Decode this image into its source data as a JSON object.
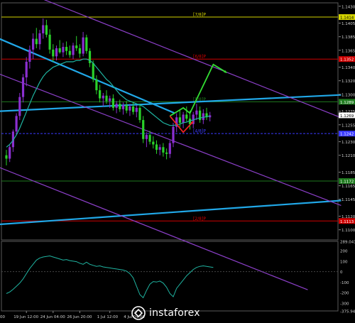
{
  "chart_data": {
    "type": "candlestick",
    "instrument_note": "",
    "price_axis": {
      "ylim": [
        1.1085,
        1.1435
      ],
      "tick_labels": [
        "1.1430",
        "1.1405",
        "1.1385",
        "1.1365",
        "1.1340",
        "1.1320",
        "1.1300",
        "1.1275",
        "1.1255",
        "1.1230",
        "1.1210",
        "1.1185",
        "1.1165",
        "1.1145",
        "1.1120",
        "1.1100"
      ],
      "price_tag": "1.1269"
    },
    "date_axis": {
      "tick_labels": [
        "19 Jun 12:00",
        "24 Jun 04:00",
        "26 Jun 20:00",
        "1 Jul 12:00",
        "4 Jul 04:00"
      ],
      "last_label_partial": "00"
    },
    "murray_levels": [
      {
        "label": "[7/8]P",
        "price": 1.1414,
        "tag": "1.1414",
        "color": "#d4d400"
      },
      {
        "label": "[6/8]P",
        "price": 1.1352,
        "tag": "1.1352",
        "color": "#d00000"
      },
      {
        "label": "[5/8]P",
        "price": 1.1289,
        "tag": "1.1289",
        "color": "#1e7a1e"
      },
      {
        "label": "[4/8]P",
        "price": 1.1242,
        "tag": "1.1242",
        "color": "#3a3aff"
      },
      {
        "label": "",
        "price": 1.1172,
        "tag": "1.1172",
        "color": "#1e7a1e"
      },
      {
        "label": "[2/8]P",
        "price": 1.1113,
        "tag": "1.1113",
        "color": "#d00000"
      }
    ],
    "candles": [
      {
        "o": 1.121,
        "h": 1.1218,
        "l": 1.1195,
        "c": 1.1205
      },
      {
        "o": 1.1205,
        "h": 1.1225,
        "l": 1.12,
        "c": 1.1222
      },
      {
        "o": 1.1222,
        "h": 1.1248,
        "l": 1.1215,
        "c": 1.1245
      },
      {
        "o": 1.1245,
        "h": 1.1272,
        "l": 1.124,
        "c": 1.1268
      },
      {
        "o": 1.1268,
        "h": 1.1302,
        "l": 1.1262,
        "c": 1.1296
      },
      {
        "o": 1.1296,
        "h": 1.133,
        "l": 1.1288,
        "c": 1.1325
      },
      {
        "o": 1.1325,
        "h": 1.1355,
        "l": 1.1312,
        "c": 1.1348
      },
      {
        "o": 1.1348,
        "h": 1.1372,
        "l": 1.1338,
        "c": 1.1366
      },
      {
        "o": 1.1366,
        "h": 1.139,
        "l": 1.1352,
        "c": 1.1382
      },
      {
        "o": 1.1382,
        "h": 1.1398,
        "l": 1.1368,
        "c": 1.1374
      },
      {
        "o": 1.1374,
        "h": 1.1395,
        "l": 1.1366,
        "c": 1.139
      },
      {
        "o": 1.139,
        "h": 1.1412,
        "l": 1.1382,
        "c": 1.1402
      },
      {
        "o": 1.1402,
        "h": 1.141,
        "l": 1.1384,
        "c": 1.1388
      },
      {
        "o": 1.1388,
        "h": 1.1396,
        "l": 1.136,
        "c": 1.1366
      },
      {
        "o": 1.1366,
        "h": 1.1374,
        "l": 1.1348,
        "c": 1.1356
      },
      {
        "o": 1.1356,
        "h": 1.1372,
        "l": 1.135,
        "c": 1.1368
      },
      {
        "o": 1.1368,
        "h": 1.138,
        "l": 1.136,
        "c": 1.1362
      },
      {
        "o": 1.1362,
        "h": 1.1376,
        "l": 1.1355,
        "c": 1.137
      },
      {
        "o": 1.137,
        "h": 1.1378,
        "l": 1.1358,
        "c": 1.1364
      },
      {
        "o": 1.1364,
        "h": 1.1372,
        "l": 1.1354,
        "c": 1.1358
      },
      {
        "o": 1.1358,
        "h": 1.1376,
        "l": 1.1352,
        "c": 1.1372
      },
      {
        "o": 1.1372,
        "h": 1.1386,
        "l": 1.1364,
        "c": 1.1368
      },
      {
        "o": 1.1368,
        "h": 1.1374,
        "l": 1.1354,
        "c": 1.136
      },
      {
        "o": 1.136,
        "h": 1.1392,
        "l": 1.1356,
        "c": 1.1384
      },
      {
        "o": 1.1384,
        "h": 1.1388,
        "l": 1.136,
        "c": 1.1364
      },
      {
        "o": 1.1364,
        "h": 1.1368,
        "l": 1.134,
        "c": 1.1346
      },
      {
        "o": 1.1346,
        "h": 1.135,
        "l": 1.1318,
        "c": 1.1322
      },
      {
        "o": 1.1322,
        "h": 1.1328,
        "l": 1.13,
        "c": 1.1306
      },
      {
        "o": 1.1306,
        "h": 1.1314,
        "l": 1.1288,
        "c": 1.1294
      },
      {
        "o": 1.1294,
        "h": 1.1302,
        "l": 1.1282,
        "c": 1.1298
      },
      {
        "o": 1.1298,
        "h": 1.1306,
        "l": 1.1286,
        "c": 1.129
      },
      {
        "o": 1.129,
        "h": 1.1298,
        "l": 1.128,
        "c": 1.1294
      },
      {
        "o": 1.1294,
        "h": 1.13,
        "l": 1.1276,
        "c": 1.128
      },
      {
        "o": 1.128,
        "h": 1.129,
        "l": 1.1272,
        "c": 1.1286
      },
      {
        "o": 1.1286,
        "h": 1.1292,
        "l": 1.1274,
        "c": 1.1278
      },
      {
        "o": 1.1278,
        "h": 1.1288,
        "l": 1.127,
        "c": 1.1284
      },
      {
        "o": 1.1284,
        "h": 1.129,
        "l": 1.1272,
        "c": 1.1276
      },
      {
        "o": 1.1276,
        "h": 1.1286,
        "l": 1.1268,
        "c": 1.1282
      },
      {
        "o": 1.1282,
        "h": 1.1288,
        "l": 1.127,
        "c": 1.1274
      },
      {
        "o": 1.1274,
        "h": 1.1284,
        "l": 1.1266,
        "c": 1.128
      },
      {
        "o": 1.128,
        "h": 1.1286,
        "l": 1.1258,
        "c": 1.1262
      },
      {
        "o": 1.1262,
        "h": 1.1268,
        "l": 1.1228,
        "c": 1.1234
      },
      {
        "o": 1.1234,
        "h": 1.1244,
        "l": 1.1222,
        "c": 1.124
      },
      {
        "o": 1.124,
        "h": 1.1246,
        "l": 1.1226,
        "c": 1.123
      },
      {
        "o": 1.123,
        "h": 1.1238,
        "l": 1.122,
        "c": 1.1226
      },
      {
        "o": 1.1226,
        "h": 1.1232,
        "l": 1.1212,
        "c": 1.1218
      },
      {
        "o": 1.1218,
        "h": 1.1226,
        "l": 1.121,
        "c": 1.1222
      },
      {
        "o": 1.1222,
        "h": 1.1228,
        "l": 1.1208,
        "c": 1.1214
      },
      {
        "o": 1.1214,
        "h": 1.122,
        "l": 1.1204,
        "c": 1.1212
      },
      {
        "o": 1.1212,
        "h": 1.1232,
        "l": 1.1206,
        "c": 1.1228
      },
      {
        "o": 1.1228,
        "h": 1.1258,
        "l": 1.1222,
        "c": 1.1252
      },
      {
        "o": 1.1252,
        "h": 1.1272,
        "l": 1.1244,
        "c": 1.1266
      },
      {
        "o": 1.1266,
        "h": 1.1278,
        "l": 1.1252,
        "c": 1.1258
      },
      {
        "o": 1.1258,
        "h": 1.1274,
        "l": 1.125,
        "c": 1.127
      },
      {
        "o": 1.127,
        "h": 1.1282,
        "l": 1.126,
        "c": 1.1264
      },
      {
        "o": 1.1264,
        "h": 1.1276,
        "l": 1.1248,
        "c": 1.1256
      },
      {
        "o": 1.1256,
        "h": 1.1274,
        "l": 1.125,
        "c": 1.127
      },
      {
        "o": 1.127,
        "h": 1.1286,
        "l": 1.1262,
        "c": 1.1276
      },
      {
        "o": 1.1276,
        "h": 1.1282,
        "l": 1.1258,
        "c": 1.1262
      },
      {
        "o": 1.1262,
        "h": 1.1278,
        "l": 1.1256,
        "c": 1.1272
      },
      {
        "o": 1.1272,
        "h": 1.128,
        "l": 1.1262,
        "c": 1.1266
      },
      {
        "o": 1.1266,
        "h": 1.1274,
        "l": 1.126,
        "c": 1.1269
      }
    ],
    "moving_average": [
      1.1222,
      1.1226,
      1.1232,
      1.124,
      1.125,
      1.1262,
      1.1274,
      1.1286,
      1.1298,
      1.1308,
      1.1318,
      1.1326,
      1.1332,
      1.1336,
      1.134,
      1.1342,
      1.1344,
      1.1346,
      1.1348,
      1.1348,
      1.1348,
      1.135,
      1.135,
      1.1352,
      1.1352,
      1.135,
      1.1346,
      1.134,
      1.1334,
      1.1328,
      1.1322,
      1.1318,
      1.1312,
      1.1306,
      1.13,
      1.1296,
      1.1292,
      1.129,
      1.1288,
      1.1286,
      1.1284,
      1.1282,
      1.1278,
      1.1274,
      1.127,
      1.1266,
      1.1262,
      1.1258,
      1.1256,
      1.1254,
      1.1254,
      1.1255,
      1.1256,
      1.1258,
      1.1259,
      1.1261,
      1.1262,
      1.1264,
      1.1265,
      1.1266,
      1.1267,
      1.1268
    ],
    "channel_lines": [
      {
        "color": "#21a8e8",
        "points": [
          [
            0,
            1.1275
          ],
          [
            62,
            1.1338
          ]
        ]
      },
      {
        "color": "#21a8e8",
        "points": [
          [
            0,
            1.1108
          ],
          [
            62,
            1.12
          ]
        ]
      },
      {
        "color": "#21a8e8",
        "points": [
          [
            0,
            1.1382
          ],
          [
            12,
            1.1432
          ]
        ]
      }
    ],
    "trend_lines": [
      {
        "color": "#8b3fc8",
        "points": [
          [
            0,
            1.133
          ],
          [
            62,
            1.121
          ]
        ]
      },
      {
        "color": "#8b3fc8",
        "points": [
          [
            0,
            1.1192
          ],
          [
            52,
            1.1088
          ]
        ]
      },
      {
        "color": "#8b3fc8",
        "points": [
          [
            0,
            1.1466
          ],
          [
            62,
            1.1342
          ]
        ]
      }
    ],
    "forecast_paths": [
      {
        "color": "#33dd33",
        "points": [
          [
            49,
            1.1268
          ],
          [
            53,
            1.128
          ],
          [
            55,
            1.1272
          ],
          [
            62,
            1.1344
          ],
          [
            66,
            1.1332
          ]
        ]
      },
      {
        "color": "#ee2222",
        "points": [
          [
            49,
            1.1268
          ],
          [
            53,
            1.1244
          ],
          [
            56,
            1.126
          ]
        ]
      }
    ],
    "oscillator": {
      "ylim": [
        -375.947,
        289.041
      ],
      "tick_labels": [
        "289.041",
        "200",
        "100",
        "0",
        "-100",
        "-200",
        "-300",
        "-375.947"
      ],
      "values": [
        -210,
        -195,
        -170,
        -140,
        -110,
        -70,
        -20,
        30,
        70,
        110,
        130,
        140,
        145,
        150,
        140,
        130,
        120,
        110,
        115,
        105,
        100,
        95,
        80,
        70,
        90,
        70,
        60,
        50,
        55,
        45,
        40,
        35,
        30,
        25,
        20,
        15,
        5,
        -20,
        -60,
        -140,
        -220,
        -250,
        -180,
        -120,
        -95,
        -100,
        -90,
        -110,
        -150,
        -210,
        -240,
        -160,
        -120,
        -80,
        -40,
        -10,
        20,
        40,
        50,
        55,
        50,
        45,
        40
      ]
    },
    "watermark": "instaforex"
  }
}
